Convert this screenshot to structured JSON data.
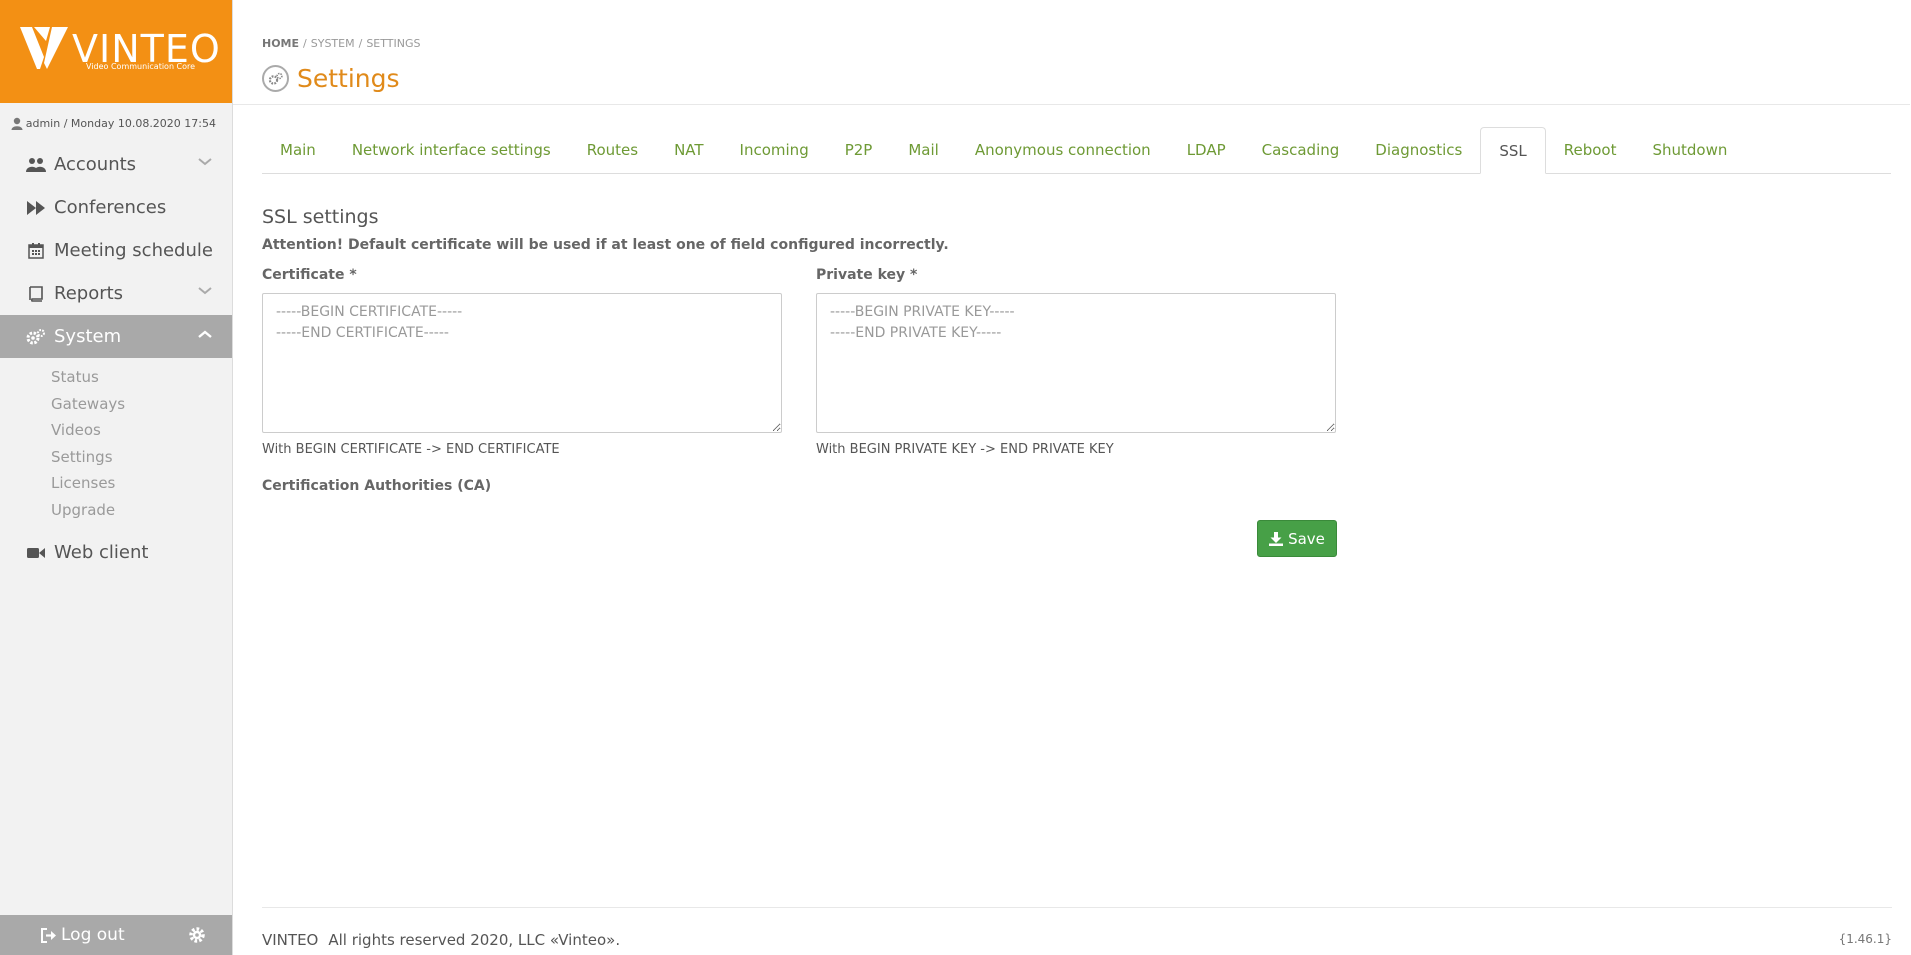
{
  "brand": {
    "name": "VINTEO",
    "tagline": "Video Communication Core",
    "color": "#f39014"
  },
  "user_info": "admin / Monday 10.08.2020 17:54",
  "sidebar": {
    "items": [
      {
        "label": "Accounts",
        "icon": "users-icon",
        "expandable": true
      },
      {
        "label": "Conferences",
        "icon": "fast-forward-icon",
        "expandable": false
      },
      {
        "label": "Meeting schedule",
        "icon": "calendar-icon",
        "expandable": false
      },
      {
        "label": "Reports",
        "icon": "book-icon",
        "expandable": true
      },
      {
        "label": "System",
        "icon": "gears-icon",
        "expandable": true,
        "active": true
      },
      {
        "label": "Web client",
        "icon": "video-camera-icon",
        "expandable": false
      }
    ],
    "subitems": [
      "Status",
      "Gateways",
      "Videos",
      "Settings",
      "Licenses",
      "Upgrade"
    ],
    "logout_label": "Log out"
  },
  "breadcrumb": {
    "home": "HOME",
    "system": "SYSTEM",
    "settings": "SETTINGS"
  },
  "page_title": "Settings",
  "tabs": [
    "Main",
    "Network interface settings",
    "Routes",
    "NAT",
    "Incoming",
    "P2P",
    "Mail",
    "Anonymous connection",
    "LDAP",
    "Cascading",
    "Diagnostics",
    "SSL",
    "Reboot",
    "Shutdown"
  ],
  "active_tab": "SSL",
  "ssl": {
    "section_title": "SSL settings",
    "attention": "Attention! Default certificate will be used if at least one of field configured incorrectly.",
    "certificate_label": "Certificate *",
    "certificate_placeholder": "-----BEGIN CERTIFICATE-----\n-----END CERTIFICATE-----",
    "certificate_help": "With BEGIN CERTIFICATE -> END CERTIFICATE",
    "private_key_label": "Private key *",
    "private_key_placeholder": "-----BEGIN PRIVATE KEY-----\n-----END PRIVATE KEY-----",
    "private_key_help": "With BEGIN PRIVATE KEY -> END PRIVATE KEY",
    "ca_label": "Certification Authorities (CA)",
    "save_label": "Save"
  },
  "footer": {
    "brand": "VINTEO",
    "rights": "All rights reserved 2020, LLC «Vinteo».",
    "version": "{1.46.1}"
  },
  "colors": {
    "tab_link": "#6e9a35",
    "title": "#e08a1a",
    "save_button": "#47a047",
    "active_nav": "#a9a9a9"
  }
}
